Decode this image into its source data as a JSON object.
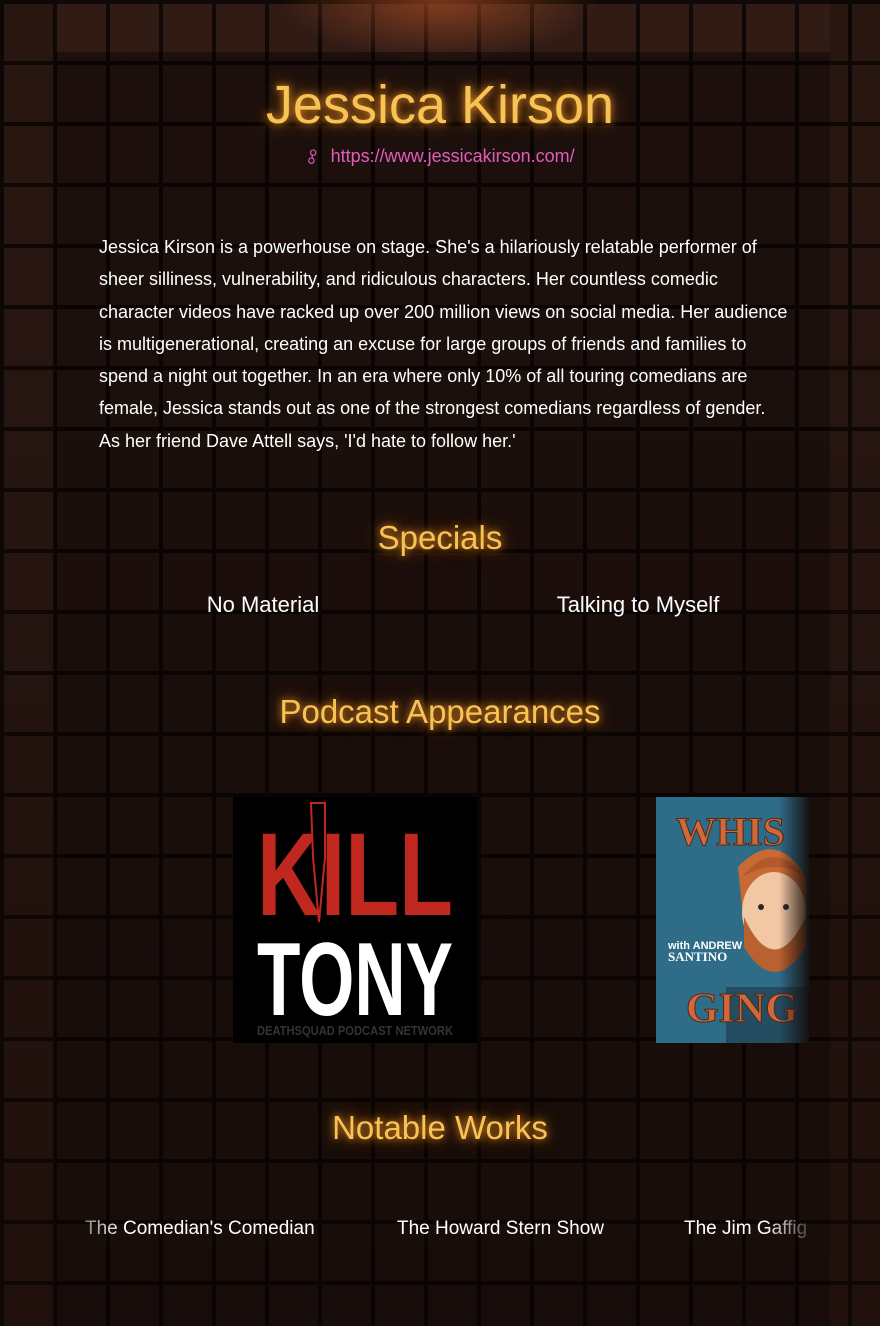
{
  "comedian": {
    "name": "Jessica Kirson",
    "website": "https://www.jessicakirson.com/",
    "bio": "Jessica Kirson is a powerhouse on stage. She's a hilariously relatable performer of sheer silliness, vulnerability, and ridiculous characters. Her countless comedic character videos have racked up over 200 million views on social media. Her audience is multigenerational, creating an excuse for large groups of friends and families to spend a night out together. In an era where only 10% of all touring comedians are female, Jessica stands out as one of the strongest comedians regardless of gender. As her friend Dave Attell says, 'I'd hate to follow her.'"
  },
  "sections": {
    "specials_title": "Specials",
    "podcasts_title": "Podcast Appearances",
    "works_title": "Notable Works"
  },
  "specials": [
    "No Material",
    "Talking to Myself"
  ],
  "podcasts": [
    {
      "title_top": "KILL",
      "title_bottom": "TONY",
      "network": "DEATHSQUAD PODCAST NETWORK"
    },
    {
      "title_top": "WHIS",
      "with": "with ANDREW",
      "host": "SANTINO",
      "title_bottom": "GING"
    }
  ],
  "notable_works": [
    "The Comedian's Comedian",
    "The Howard Stern Show",
    "The Jim Gaffig"
  ],
  "icons": {
    "website": "link-icon"
  },
  "colors": {
    "accent": "#f7c355",
    "link": "#e25dbb"
  }
}
